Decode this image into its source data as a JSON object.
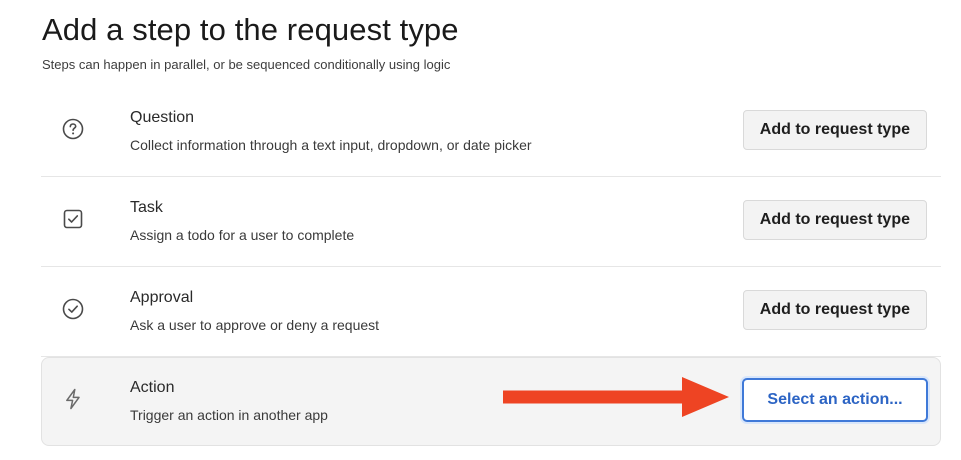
{
  "page": {
    "title": "Add a step to the request type",
    "subtitle": "Steps can happen in parallel, or be sequenced conditionally using logic"
  },
  "steps": [
    {
      "icon": "question-circle-icon",
      "title": "Question",
      "description": "Collect information through a text input, dropdown, or date picker",
      "button_label": "Add to request type"
    },
    {
      "icon": "checkbox-icon",
      "title": "Task",
      "description": "Assign a todo for a user to complete",
      "button_label": "Add to request type"
    },
    {
      "icon": "check-circle-icon",
      "title": "Approval",
      "description": "Ask a user to approve or deny a request",
      "button_label": "Add to request type"
    },
    {
      "icon": "lightning-icon",
      "title": "Action",
      "description": "Trigger an action in another app",
      "button_label": "Select an action..."
    }
  ],
  "colors": {
    "annotation_arrow": "#ee4423",
    "select_button_border": "#3f79d8",
    "select_button_text": "#2c64c4",
    "highlight_row_bg": "#f4f4f4"
  }
}
